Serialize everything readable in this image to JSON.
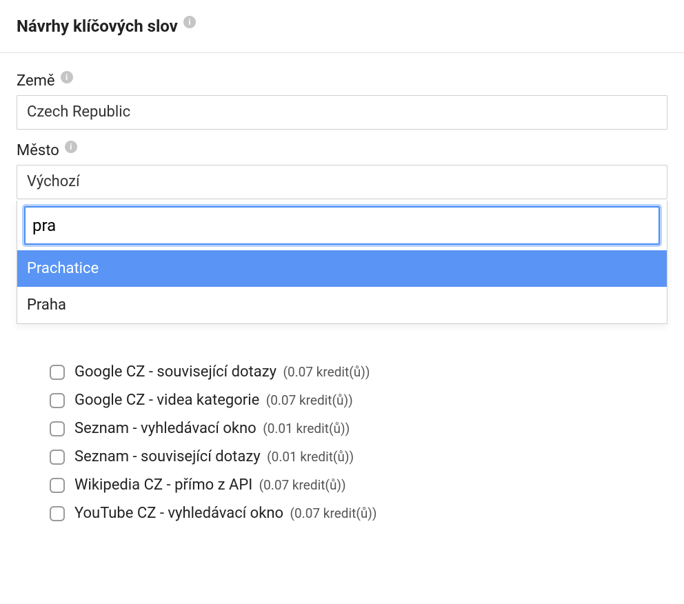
{
  "header": {
    "title": "Návrhy klíčových slov"
  },
  "country": {
    "label": "Země",
    "value": "Czech Republic"
  },
  "city": {
    "label": "Město",
    "value": "Výchozí",
    "search_value": "pra",
    "options": [
      {
        "label": "Prachatice",
        "highlighted": true
      },
      {
        "label": "Praha",
        "highlighted": false
      }
    ]
  },
  "sources": [
    {
      "label": "Google CZ - související dotazy",
      "credit": "(0.07 kredit(ů))"
    },
    {
      "label": "Google CZ - videa kategorie",
      "credit": "(0.07 kredit(ů))"
    },
    {
      "label": "Seznam - vyhledávací okno",
      "credit": "(0.01 kredit(ů))"
    },
    {
      "label": "Seznam - související dotazy",
      "credit": "(0.01 kredit(ů))"
    },
    {
      "label": "Wikipedia CZ - přímo z API",
      "credit": "(0.07 kredit(ů))"
    },
    {
      "label": "YouTube CZ - vyhledávací okno",
      "credit": "(0.07 kredit(ů))"
    }
  ]
}
